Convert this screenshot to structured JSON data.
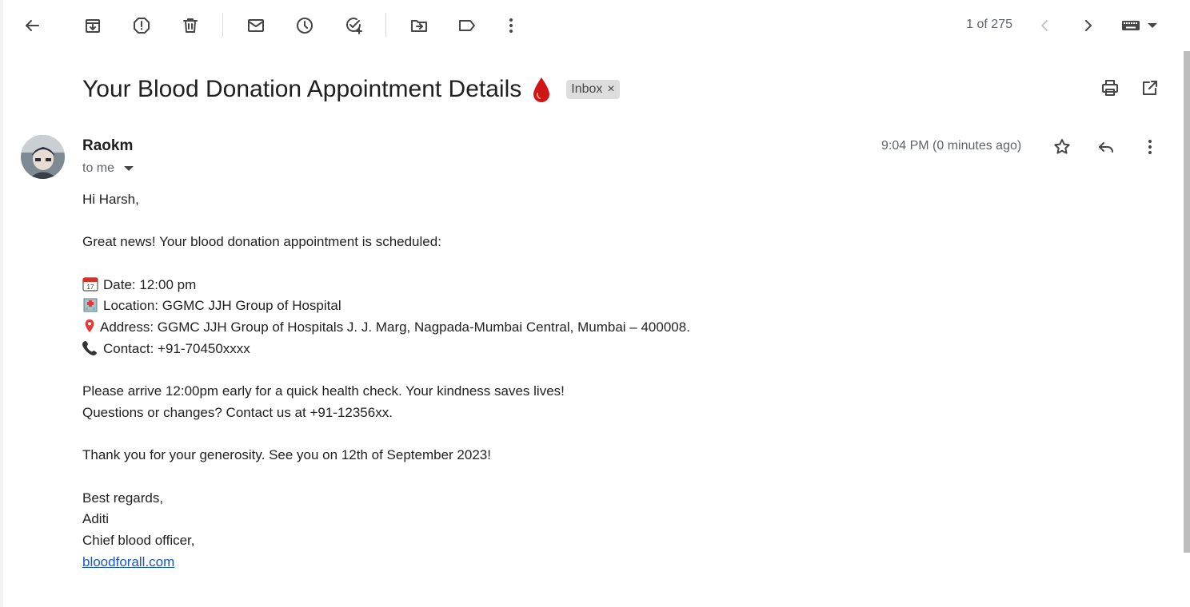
{
  "toolbar": {
    "pager_text": "1 of 275"
  },
  "email": {
    "subject": "Your Blood Donation Appointment Details",
    "label": "Inbox",
    "sender": "Raokm",
    "recipient": "to me",
    "timestamp": "9:04 PM (0 minutes ago)",
    "body": {
      "greeting": "Hi Harsh,",
      "intro": "Great news! Your blood donation appointment is scheduled:",
      "date": "Date: 12:00 pm",
      "location": "Location: GGMC JJH Group of Hospital",
      "address": "Address: GGMC JJH Group of Hospitals J. J. Marg, Nagpada-Mumbai Central, Mumbai – 400008.",
      "contact": "Contact: +91-70450xxxx",
      "arrive": "Please arrive 12:00pm early for a quick health check. Your kindness saves lives!",
      "questions": "Questions or changes? Contact us at +91-12356xx.",
      "thanks": "Thank you for your generosity. See you on 12th of September 2023!",
      "regards": "Best regards,",
      "name": "Aditi",
      "title": "Chief blood officer,",
      "website": "bloodforall.com"
    }
  },
  "colors": {
    "link": "#1a55c4",
    "drop": "#d01515",
    "chip_bg": "#dddddd"
  }
}
